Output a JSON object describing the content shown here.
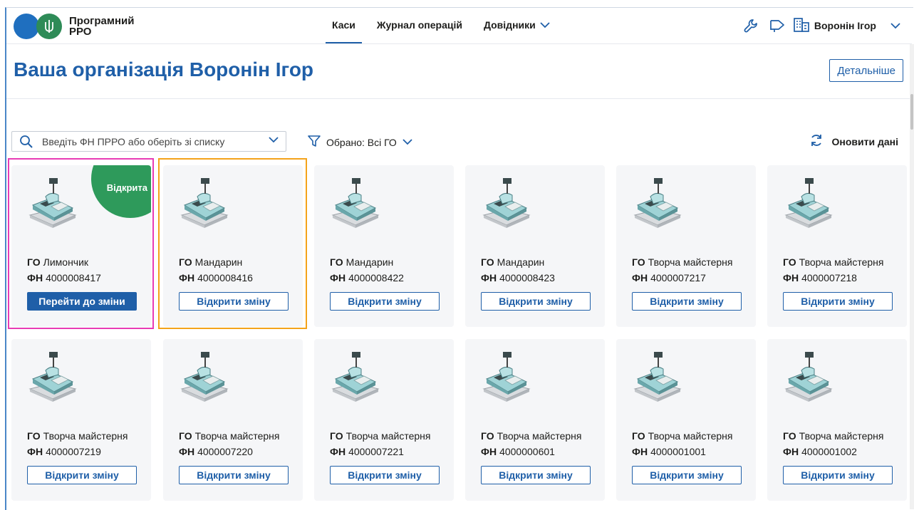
{
  "header": {
    "brand": "Програмний РРО",
    "brand_line1": "Програмний",
    "brand_line2": "РРО",
    "nav": [
      {
        "label": "Каси",
        "active": true
      },
      {
        "label": "Журнал операцій",
        "active": false
      },
      {
        "label": "Довідники",
        "active": false,
        "dropdown": true
      }
    ],
    "user_name": "Воронін Ігор",
    "icons": [
      "wrench-icon",
      "megaphone-icon",
      "building-icon",
      "chevron-down-icon"
    ]
  },
  "page": {
    "title": "Ваша організація Воронін Ігор",
    "details_button": "Детальніше"
  },
  "filters": {
    "search_placeholder": "Введіть ФН ПРРО або оберіть зі списку",
    "selected_label": "Обрано: Всі ГО",
    "refresh_label": "Оновити дані"
  },
  "labels": {
    "go": "ГО",
    "fn": "ФН"
  },
  "colors": {
    "primary": "#1f5fa8",
    "open_badge": "#2e9a5b",
    "highlight_pink": "#e83bb5",
    "highlight_orange": "#f4a31a"
  },
  "cards": [
    {
      "go": "Лимончик",
      "fn": "4000008417",
      "status": "Відкрита",
      "button": "Перейти до зміни",
      "button_style": "filled"
    },
    {
      "go": "Мандарин",
      "fn": "4000008416",
      "status": "",
      "button": "Відкрити зміну",
      "button_style": "outline"
    },
    {
      "go": "Мандарин",
      "fn": "4000008422",
      "status": "",
      "button": "Відкрити зміну",
      "button_style": "outline"
    },
    {
      "go": "Мандарин",
      "fn": "4000008423",
      "status": "",
      "button": "Відкрити зміну",
      "button_style": "outline"
    },
    {
      "go": "Творча майстерня",
      "fn": "4000007217",
      "status": "",
      "button": "Відкрити зміну",
      "button_style": "outline"
    },
    {
      "go": "Творча майстерня",
      "fn": "4000007218",
      "status": "",
      "button": "Відкрити зміну",
      "button_style": "outline"
    },
    {
      "go": "Творча майстерня",
      "fn": "4000007219",
      "status": "",
      "button": "Відкрити зміну",
      "button_style": "outline"
    },
    {
      "go": "Творча майстерня",
      "fn": "4000007220",
      "status": "",
      "button": "Відкрити зміну",
      "button_style": "outline"
    },
    {
      "go": "Творча майстерня",
      "fn": "4000007221",
      "status": "",
      "button": "Відкрити зміну",
      "button_style": "outline"
    },
    {
      "go": "Творча майстерня",
      "fn": "4000000601",
      "status": "",
      "button": "Відкрити зміну",
      "button_style": "outline"
    },
    {
      "go": "Творча майстерня",
      "fn": "4000001001",
      "status": "",
      "button": "Відкрити зміну",
      "button_style": "outline"
    },
    {
      "go": "Творча майстерня",
      "fn": "4000001002",
      "status": "",
      "button": "Відкрити зміну",
      "button_style": "outline"
    }
  ]
}
